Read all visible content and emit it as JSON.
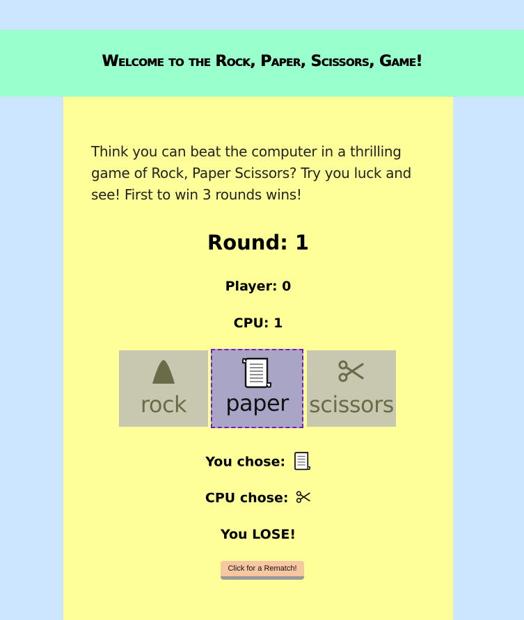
{
  "header": {
    "title": "Welcome to the Rock, Paper, Scissors, Game!"
  },
  "intro": {
    "text": "Think you can beat the computer in a thrilling game of Rock, Paper Scissors? Try you luck and see! First to win 3 rounds wins!"
  },
  "score": {
    "round_text": "Round: 1",
    "player_text": "Player: 0",
    "cpu_text": "CPU: 1"
  },
  "choices": [
    {
      "label": "rock",
      "icon": "rock-icon",
      "selected": false
    },
    {
      "label": "paper",
      "icon": "paper-icon",
      "selected": true
    },
    {
      "label": "scissors",
      "icon": "scissors-icon",
      "selected": false
    }
  ],
  "outcome": {
    "you_chose_label": "You chose:",
    "you_chose_icon": "paper-icon",
    "cpu_chose_label": "CPU chose:",
    "cpu_chose_icon": "scissors-icon",
    "result_text": "You LOSE!"
  },
  "rematch": {
    "label": "Click for a Rematch!"
  },
  "colors": {
    "page_background": "#cce6ff",
    "banner_background": "#99ffcc",
    "panel_background": "#ffff99",
    "choice_background": "#c8c8b0",
    "selected_choice_background": "#a8a5c7",
    "selected_border": "#7b17c0",
    "rematch_background": "#f7c7a1"
  }
}
